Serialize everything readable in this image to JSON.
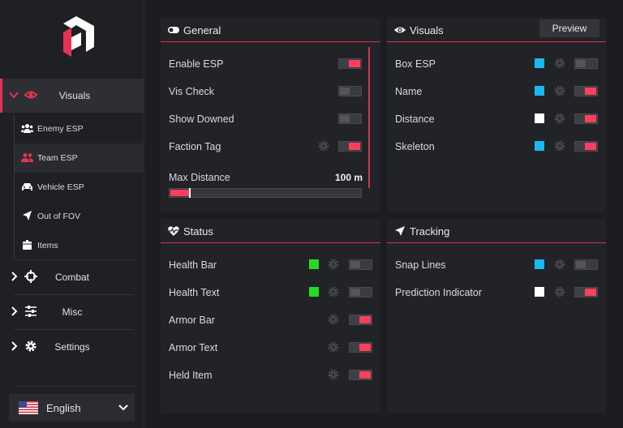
{
  "sidebar": {
    "visuals_label": "Visuals",
    "sub_items": [
      {
        "label": "Enemy ESP",
        "icon": "users-icon"
      },
      {
        "label": "Team ESP",
        "icon": "users-icon"
      },
      {
        "label": "Vehicle ESP",
        "icon": "car-icon"
      },
      {
        "label": "Out of FOV",
        "icon": "arrow-icon"
      },
      {
        "label": "Items",
        "icon": "box-icon"
      }
    ],
    "active_sub": "Team ESP",
    "combat_label": "Combat",
    "misc_label": "Misc",
    "settings_label": "Settings",
    "language": "English"
  },
  "colors": {
    "accent": "#ff3f5c",
    "cyan": "#1ab8f0",
    "green": "#22dd22",
    "white": "#ffffff"
  },
  "general": {
    "title": "General",
    "rows": [
      {
        "label": "Enable ESP",
        "on": true,
        "gear": false
      },
      {
        "label": "Vis Check",
        "on": false,
        "gear": false
      },
      {
        "label": "Show Downed",
        "on": false,
        "gear": false
      },
      {
        "label": "Faction Tag",
        "on": true,
        "gear": true
      }
    ],
    "max_distance_label": "Max Distance",
    "max_distance_value": "100 m",
    "max_distance_fraction": 0.1
  },
  "visuals": {
    "title": "Visuals",
    "preview_label": "Preview",
    "rows": [
      {
        "label": "Box ESP",
        "color": "cyan",
        "on": false
      },
      {
        "label": "Name",
        "color": "cyan",
        "on": true
      },
      {
        "label": "Distance",
        "color": "white",
        "on": true
      },
      {
        "label": "Skeleton",
        "color": "cyan",
        "on": true
      }
    ]
  },
  "status": {
    "title": "Status",
    "rows": [
      {
        "label": "Health Bar",
        "color": "green",
        "on": false
      },
      {
        "label": "Health Text",
        "color": "green",
        "on": false
      },
      {
        "label": "Armor Bar",
        "color": null,
        "on": true
      },
      {
        "label": "Armor Text",
        "color": null,
        "on": true
      },
      {
        "label": "Held Item",
        "color": null,
        "on": true
      }
    ]
  },
  "tracking": {
    "title": "Tracking",
    "rows": [
      {
        "label": "Snap Lines",
        "color": "cyan",
        "on": false
      },
      {
        "label": "Prediction Indicator",
        "color": "white",
        "on": true
      }
    ]
  }
}
